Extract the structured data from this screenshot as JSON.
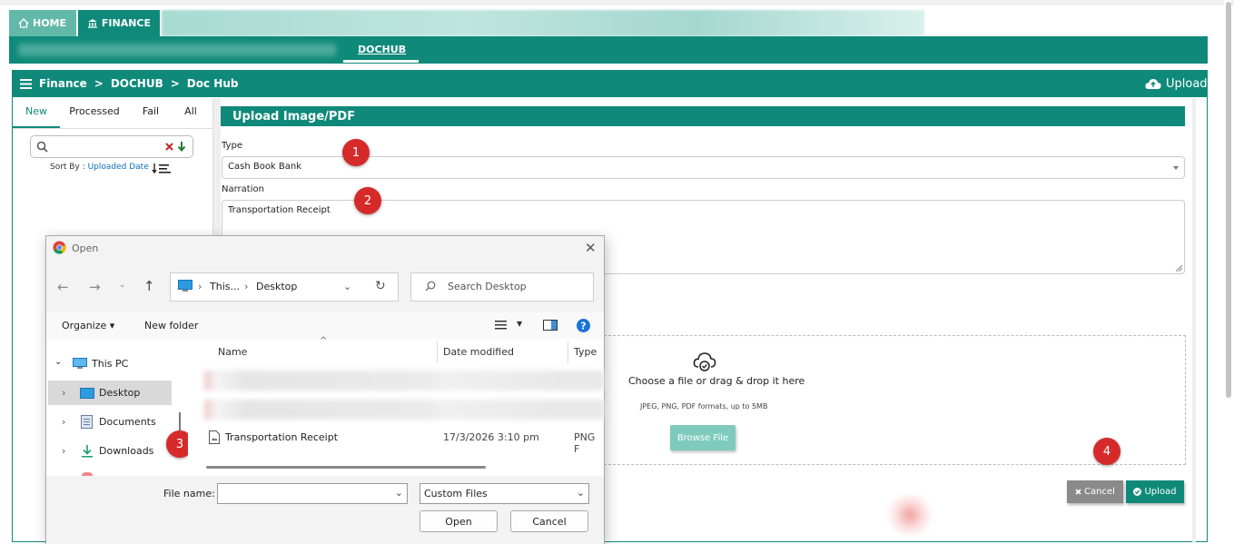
{
  "top_tabs": {
    "home": "HOME",
    "finance": "FINANCE"
  },
  "subnav": {
    "active": "DOCHUB"
  },
  "breadcrumb": {
    "finance": "Finance",
    "dochub": "DOCHUB",
    "dochub_page": "Doc Hub"
  },
  "header": {
    "upload": "Upload"
  },
  "left": {
    "tabs": [
      "New",
      "Processed",
      "Fail",
      "All"
    ],
    "sort_by_label": "Sort By :",
    "sort_by_value": "Uploaded Date"
  },
  "form": {
    "title": "Upload Image/PDF",
    "type_label": "Type",
    "type_value": "Cash Book Bank",
    "narration_label": "Narration",
    "narration_value": "Transportation Receipt",
    "drop_text": "Choose a file or drag & drop it here",
    "drop_sub": "JPEG, PNG, PDF formats, up to 5MB",
    "browse": "Browse File",
    "cancel": "Cancel",
    "upload": "Upload"
  },
  "badges": [
    "1",
    "2",
    "3",
    "4"
  ],
  "dialog": {
    "title": "Open",
    "address_this": "This...",
    "address_desktop": "Desktop",
    "search_placeholder": "Search Desktop",
    "organize": "Organize",
    "new_folder": "New folder",
    "tree": [
      "This PC",
      "Desktop",
      "Documents",
      "Downloads"
    ],
    "columns": [
      "Name",
      "Date modified",
      "Type"
    ],
    "file": {
      "name": "Transportation Receipt",
      "date": "17/3/2026 3:10 pm",
      "type": "PNG F"
    },
    "file_name_label": "File name:",
    "file_type": "Custom Files",
    "open": "Open",
    "cancel": "Cancel"
  },
  "colors": {
    "brand": "#0f8a7a",
    "badge": "#d62a2a",
    "cancel": "#8a8a8a"
  }
}
